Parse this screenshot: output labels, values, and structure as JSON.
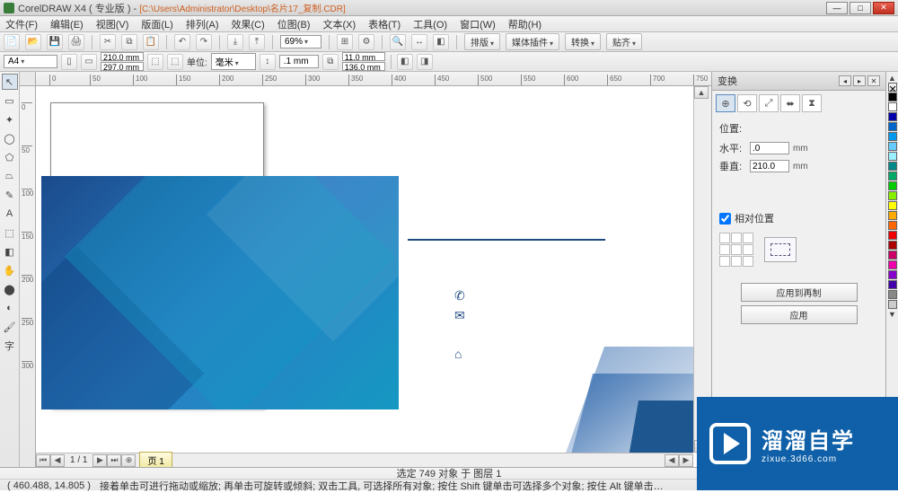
{
  "title": {
    "app": "CorelDRAW X4 ( 专业版 ) - ",
    "path": "[C:\\Users\\Administrator\\Desktop\\名片17_复制.CDR]"
  },
  "window_controls": {
    "min": "—",
    "max": "□",
    "close": "✕"
  },
  "menu": [
    "文件(F)",
    "编辑(E)",
    "视图(V)",
    "版面(L)",
    "排列(A)",
    "效果(C)",
    "位图(B)",
    "文本(X)",
    "表格(T)",
    "工具(O)",
    "窗口(W)",
    "帮助(H)"
  ],
  "toolbar1": {
    "zoom": "69%",
    "buttons": [
      "新建",
      "打开",
      "保存",
      "打印",
      "剪切",
      "复制",
      "粘贴",
      "撤销",
      "重做",
      "导入",
      "导出"
    ],
    "labels": {
      "paste": "贴齐",
      "welcome": "媒体插件",
      "transform": "转换",
      "publish": "排版"
    }
  },
  "propbar": {
    "page": "A4",
    "orient_icons": [
      "⬚",
      "⬚"
    ],
    "width": "210.0 mm",
    "height": "297.0 mm",
    "unit_label": "单位:",
    "unit": "毫米",
    "nudge": ".1 mm",
    "dup_x": "11.0 mm",
    "dup_y": "136.0 mm"
  },
  "ruler_ticks_h": [
    "0",
    "50",
    "100",
    "150",
    "200",
    "250",
    "300",
    "350",
    "400",
    "450",
    "500",
    "550",
    "600",
    "650",
    "700",
    "750"
  ],
  "ruler_ticks_v": [
    "0",
    "50",
    "100",
    "150",
    "200",
    "250",
    "300"
  ],
  "toolbox": [
    "↖",
    "▭",
    "✦",
    "◯",
    "⬠",
    "⏢",
    "✎",
    "A",
    "⬚",
    "◧",
    "✋",
    "⬤",
    "◐",
    "🖌",
    "字"
  ],
  "page_nav": {
    "counter": "1 / 1",
    "tab": "页 1"
  },
  "docker": {
    "title": "变换",
    "position_label": "位置:",
    "hx_label": "水平:",
    "hx": ".0",
    "vy_label": "垂直:",
    "vy": "210.0",
    "unit": "mm",
    "rel_label": "相对位置",
    "apply_copy": "应用到再制",
    "apply": "应用"
  },
  "status": {
    "selection": "选定 749 对象 于 图层 1",
    "coord": "( 460.488, 14.805 )",
    "hint": "接着单击可进行拖动或缩放; 再单击可旋转或倾斜; 双击工具, 可选择所有对象; 按住 Shift 键单击可选择多个对象; 按住 Alt 键单击…"
  },
  "colors": [
    "#ffffff",
    "#000000",
    "#0b2b5e",
    "#103f86",
    "#1f5fa8",
    "#2f7fc6",
    "#4fa0de",
    "#78c4f0",
    "#a0e0fa",
    "#cfeffe",
    "#ffe040",
    "#f09020",
    "#d04020",
    "#a01010",
    "#20a020",
    "#107010"
  ],
  "watermark": {
    "main": "溜溜自学",
    "sub": "zixue.3d66.com"
  },
  "icons": {
    "phone": "✆",
    "mail": "✉",
    "home": "⌂"
  }
}
